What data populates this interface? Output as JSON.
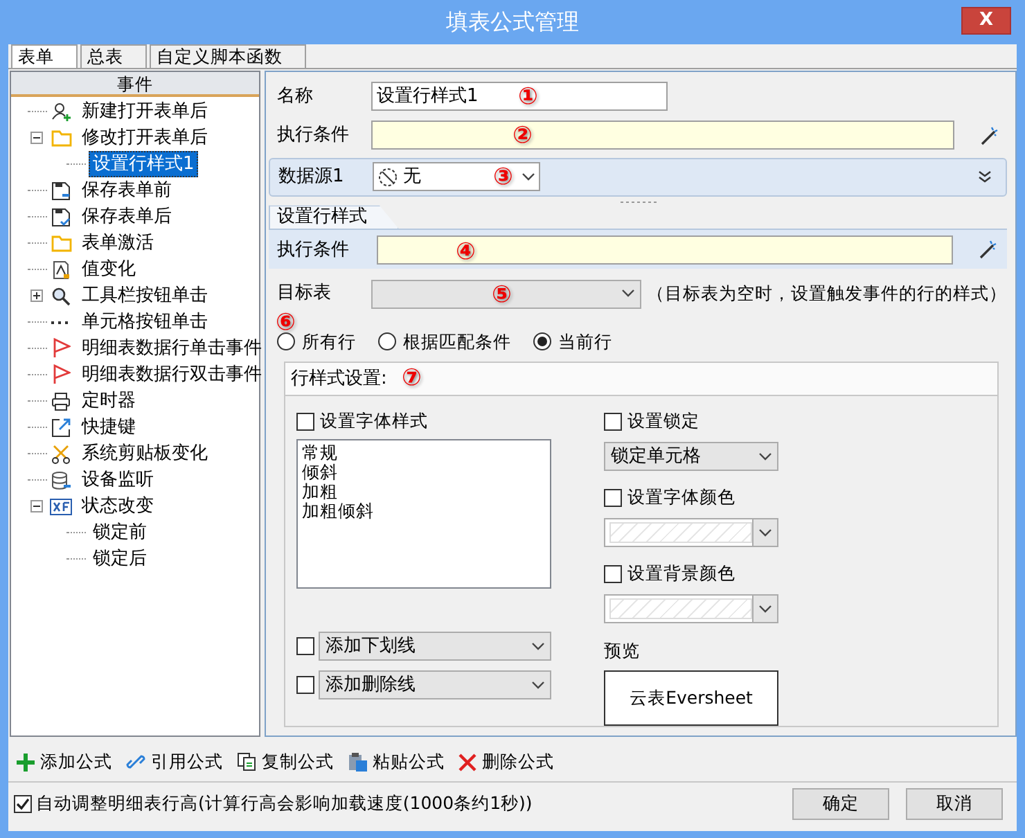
{
  "window": {
    "title": "填表公式管理",
    "close": "X"
  },
  "tabs": [
    {
      "label": "表单",
      "selected": true
    },
    {
      "label": "总表",
      "selected": false
    },
    {
      "label": "自定义脚本函数",
      "selected": false
    }
  ],
  "events": {
    "header": "事件",
    "items": [
      {
        "label": "新建打开表单后",
        "kind": "user",
        "selected": false
      },
      {
        "label": "修改打开表单后",
        "kind": "folder",
        "selected": false,
        "expanded": true,
        "children": [
          {
            "label": "设置行样式1",
            "selected": true
          }
        ]
      },
      {
        "label": "保存表单前",
        "kind": "save",
        "selected": false
      },
      {
        "label": "保存表单后",
        "kind": "save-check",
        "selected": false
      },
      {
        "label": "表单激活",
        "kind": "folder",
        "selected": false
      },
      {
        "label": "值变化",
        "kind": "value",
        "selected": false
      },
      {
        "label": "工具栏按钮单击",
        "kind": "search",
        "selected": false,
        "expanded": false
      },
      {
        "label": "单元格按钮单击",
        "kind": "dots",
        "selected": false
      },
      {
        "label": "明细表数据行单击事件",
        "kind": "flag",
        "selected": false
      },
      {
        "label": "明细表数据行双击事件",
        "kind": "flag",
        "selected": false
      },
      {
        "label": "定时器",
        "kind": "printer",
        "selected": false
      },
      {
        "label": "快捷键",
        "kind": "shortcut",
        "selected": false
      },
      {
        "label": "系统剪贴板变化",
        "kind": "scissors",
        "selected": false
      },
      {
        "label": "设备监听",
        "kind": "database",
        "selected": false
      },
      {
        "label": "状态改变",
        "kind": "xf",
        "selected": false,
        "expanded": true,
        "children": [
          {
            "label": "锁定前",
            "selected": false
          },
          {
            "label": "锁定后",
            "selected": false
          }
        ]
      }
    ]
  },
  "form": {
    "name_label": "名称",
    "name_value": "设置行样式1",
    "name_marker": "①",
    "condition_label": "执行条件",
    "condition_marker": "②",
    "datasource_label": "数据源1",
    "datasource_value": "无",
    "datasource_marker": "③"
  },
  "rule": {
    "tab": "设置行样式",
    "condition_label": "执行条件",
    "condition_marker": "④",
    "target_label": "目标表",
    "target_marker": "⑤",
    "target_hint": "（目标表为空时，设置触发事件的行的样式）",
    "scope_marker": "⑥",
    "scopes": [
      {
        "label": "所有行",
        "selected": false
      },
      {
        "label": "根据匹配条件",
        "selected": false
      },
      {
        "label": "当前行",
        "selected": true
      }
    ]
  },
  "style_group": {
    "title": "行样式设置:",
    "marker": "⑦",
    "font_style": {
      "label": "设置字体样式",
      "checked": false
    },
    "font_options": [
      "常规",
      "倾斜",
      "加粗",
      "加粗倾斜"
    ],
    "underline": {
      "value": "添加下划线",
      "checked": false
    },
    "strike": {
      "value": "添加删除线",
      "checked": false
    },
    "lock": {
      "label": "设置锁定",
      "checked": false,
      "value": "锁定单元格"
    },
    "font_color": {
      "label": "设置字体颜色",
      "checked": false
    },
    "bg_color": {
      "label": "设置背景颜色",
      "checked": false
    },
    "preview_label": "预览",
    "preview_text": "云表Eversheet"
  },
  "toolbar": [
    {
      "label": "添加公式",
      "kind": "add"
    },
    {
      "label": "引用公式",
      "kind": "link"
    },
    {
      "label": "复制公式",
      "kind": "copy"
    },
    {
      "label": "粘贴公式",
      "kind": "paste"
    },
    {
      "label": "删除公式",
      "kind": "delete"
    }
  ],
  "auto_height": {
    "label": "自动调整明细表行高(计算行高会影响加载速度(1000条约1秒))",
    "checked": true
  },
  "buttons": [
    "确定",
    "取消"
  ]
}
